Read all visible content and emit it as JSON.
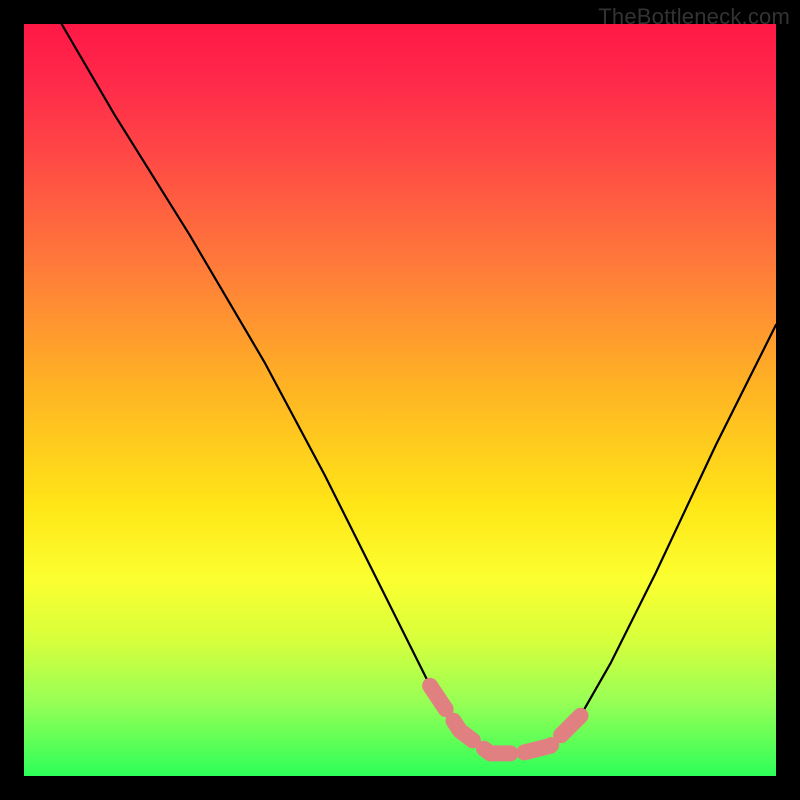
{
  "watermark": "TheBottleneck.com",
  "chart_data": {
    "type": "line",
    "title": "",
    "xlabel": "",
    "ylabel": "",
    "xlim": [
      0,
      100
    ],
    "ylim": [
      0,
      100
    ],
    "series": [
      {
        "name": "bottleneck-curve",
        "x": [
          5,
          12,
          22,
          32,
          40,
          48,
          54,
          58,
          62,
          66,
          70,
          74,
          78,
          84,
          92,
          100
        ],
        "y": [
          100,
          88,
          72,
          55,
          40,
          24,
          12,
          6,
          3,
          3,
          4,
          8,
          15,
          27,
          44,
          60
        ]
      }
    ],
    "highlight": {
      "name": "flat-min-region",
      "x": [
        54,
        58,
        62,
        66,
        70,
        74
      ],
      "y": [
        12,
        6,
        3,
        3,
        4,
        8
      ],
      "color": "#e18080"
    },
    "colors": {
      "background_gradient": [
        "#ff1846",
        "#ff7a3a",
        "#ffe617",
        "#2dff59"
      ],
      "curve": "#000000",
      "highlight": "#e18080",
      "frame": "#000000"
    }
  }
}
